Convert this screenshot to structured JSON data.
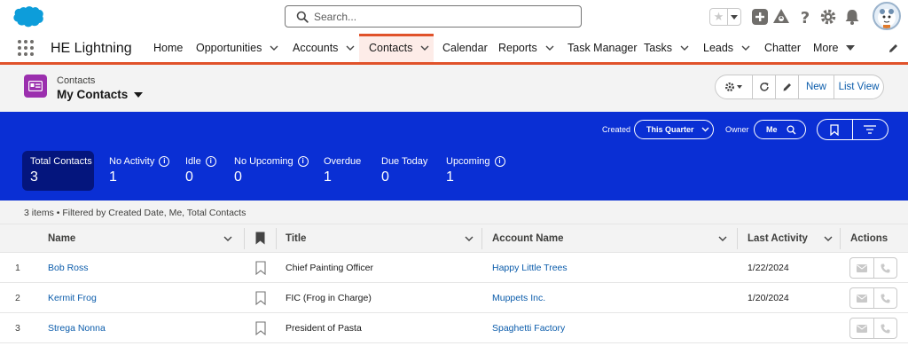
{
  "search": {
    "placeholder": "Search..."
  },
  "nav": {
    "app_name": "HE Lightning",
    "items": [
      {
        "label": "Home"
      },
      {
        "label": "Opportunities"
      },
      {
        "label": "Accounts"
      },
      {
        "label": "Contacts"
      },
      {
        "label": "Calendar"
      },
      {
        "label": "Reports"
      },
      {
        "label": "Task Manager"
      },
      {
        "label": "Tasks"
      },
      {
        "label": "Leads"
      },
      {
        "label": "Chatter"
      },
      {
        "label": "More"
      }
    ]
  },
  "list_view": {
    "object_label": "Contacts",
    "view_name": "My Contacts",
    "new_label": "New",
    "list_view_label": "List View"
  },
  "filters": {
    "created_label": "Created",
    "created_value": "This Quarter",
    "owner_label": "Owner",
    "owner_value": "Me"
  },
  "kpis": [
    {
      "label": "Total Contacts",
      "value": "3"
    },
    {
      "label": "No Activity",
      "value": "1"
    },
    {
      "label": "Idle",
      "value": "0"
    },
    {
      "label": "No Upcoming",
      "value": "0"
    },
    {
      "label": "Overdue",
      "value": "1"
    },
    {
      "label": "Due Today",
      "value": "0"
    },
    {
      "label": "Upcoming",
      "value": "1"
    }
  ],
  "table": {
    "meta": "3 items • Filtered by Created Date, Me, Total Contacts",
    "columns": {
      "name": "Name",
      "title": "Title",
      "account": "Account Name",
      "last_activity": "Last Activity",
      "actions": "Actions"
    },
    "rows": [
      {
        "num": "1",
        "name": "Bob Ross",
        "title": "Chief Painting Officer",
        "account": "Happy Little Trees",
        "last_activity": "1/22/2024"
      },
      {
        "num": "2",
        "name": "Kermit Frog",
        "title": "FIC (Frog in Charge)",
        "account": "Muppets Inc.",
        "last_activity": "1/20/2024"
      },
      {
        "num": "3",
        "name": "Strega Nonna",
        "title": "President of Pasta",
        "account": "Spaghetti Factory",
        "last_activity": ""
      }
    ]
  },
  "colors": {
    "brand_blue": "#0a2fd4",
    "nav_accent": "#e0522a",
    "link": "#0b5cab",
    "contact_icon": "#9b2fae"
  }
}
